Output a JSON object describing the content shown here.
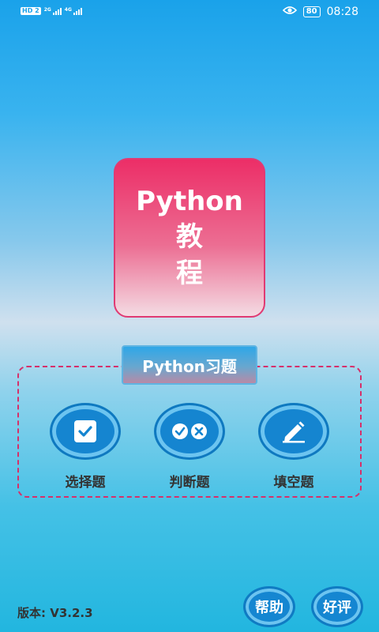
{
  "status_bar": {
    "hd_label": "HD 2",
    "network_1": "2G",
    "network_2": "4G",
    "battery": "80",
    "time": "08:28"
  },
  "title_card": {
    "line1": "Python",
    "line2": "教",
    "line3": "程"
  },
  "exercises": {
    "section_label": "Python习题",
    "options": [
      {
        "label": "选择题",
        "icon": "checkbox-icon"
      },
      {
        "label": "判断题",
        "icon": "check-cross-icon"
      },
      {
        "label": "填空题",
        "icon": "pencil-icon"
      }
    ]
  },
  "footer": {
    "version": "版本:  V3.2.3",
    "help_label": "帮助",
    "rate_label": "好评"
  },
  "colors": {
    "accent_pink": "#ec2e67",
    "button_blue": "#1585d0",
    "sky_blue": "#1aa2ea"
  }
}
